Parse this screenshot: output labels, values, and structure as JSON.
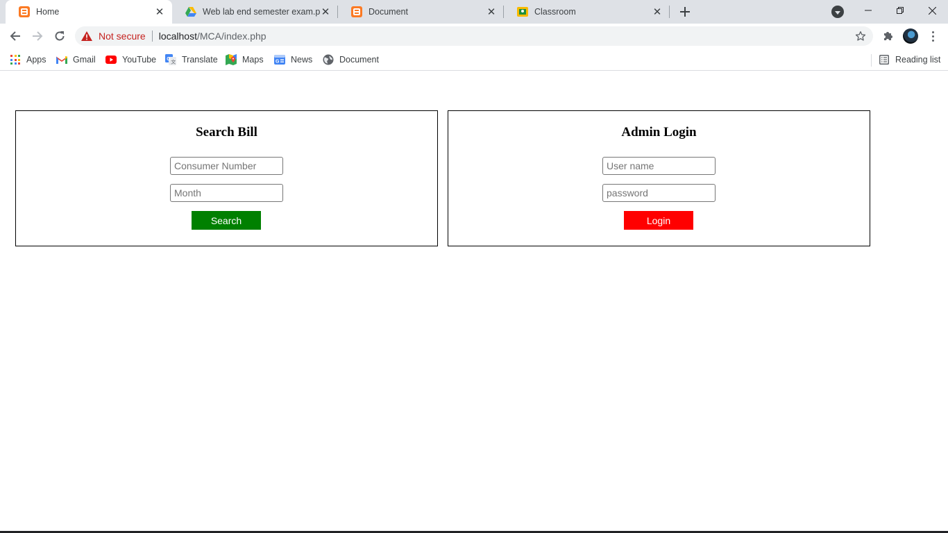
{
  "browser": {
    "tabs": [
      {
        "title": "Home",
        "icon": "xampp-icon",
        "active": true
      },
      {
        "title": "Web lab end semester exam.pdf",
        "icon": "google-drive-icon",
        "active": false
      },
      {
        "title": "Document",
        "icon": "xampp-icon",
        "active": false
      },
      {
        "title": "Classroom",
        "icon": "classroom-icon",
        "active": false
      }
    ],
    "security_label": "Not secure",
    "url_host": "localhost",
    "url_path": "/MCA/index.php",
    "bookmarks": [
      {
        "label": "Apps",
        "icon": "apps-grid-icon"
      },
      {
        "label": "Gmail",
        "icon": "gmail-icon"
      },
      {
        "label": "YouTube",
        "icon": "youtube-icon"
      },
      {
        "label": "Translate",
        "icon": "translate-icon"
      },
      {
        "label": "Maps",
        "icon": "maps-icon"
      },
      {
        "label": "News",
        "icon": "news-icon"
      },
      {
        "label": "Document",
        "icon": "globe-icon"
      }
    ],
    "reading_list_label": "Reading list"
  },
  "search_bill": {
    "title": "Search Bill",
    "consumer_number_placeholder": "Consumer Number",
    "month_placeholder": "Month",
    "button_label": "Search",
    "button_color": "#008000"
  },
  "admin_login": {
    "title": "Admin Login",
    "username_placeholder": "User name",
    "password_placeholder": "password",
    "button_label": "Login",
    "button_color": "#ff0000"
  }
}
